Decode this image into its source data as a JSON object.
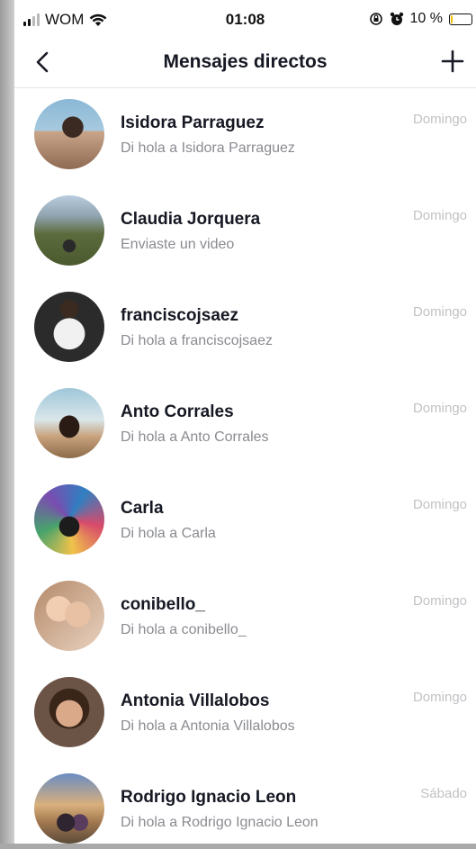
{
  "status_bar": {
    "carrier": "WOM",
    "time": "01:08",
    "battery": "10 %",
    "battery_level": 0.1,
    "icons": [
      "signal-icon",
      "wifi-icon",
      "rotation-lock-icon",
      "alarm-icon",
      "battery-icon"
    ]
  },
  "header": {
    "title": "Mensajes directos",
    "back_icon": "chevron-left-icon",
    "add_icon": "plus-icon"
  },
  "conversations": [
    {
      "name": "Isidora Parraguez",
      "preview": "Di hola a Isidora Parraguez",
      "date": "Domingo"
    },
    {
      "name": "Claudia Jorquera",
      "preview": "Enviaste un video",
      "date": "Domingo"
    },
    {
      "name": "franciscojsaez",
      "preview": "Di hola a franciscojsaez",
      "date": "Domingo"
    },
    {
      "name": "Anto Corrales",
      "preview": "Di hola a Anto Corrales",
      "date": "Domingo"
    },
    {
      "name": "Carla",
      "preview": "Di hola a Carla",
      "date": "Domingo"
    },
    {
      "name": "conibello_",
      "preview": "Di hola a conibello_",
      "date": "Domingo"
    },
    {
      "name": "Antonia Villalobos",
      "preview": "Di hola a Antonia Villalobos",
      "date": "Domingo"
    },
    {
      "name": "Rodrigo Ignacio Leon",
      "preview": "Di hola a Rodrigo Ignacio Leon",
      "date": "Sábado"
    }
  ],
  "colors": {
    "title_text": "#161823",
    "preview_text": "#8a8b91",
    "date_text": "#c2c2c6",
    "battery_low": "#f2c200"
  }
}
